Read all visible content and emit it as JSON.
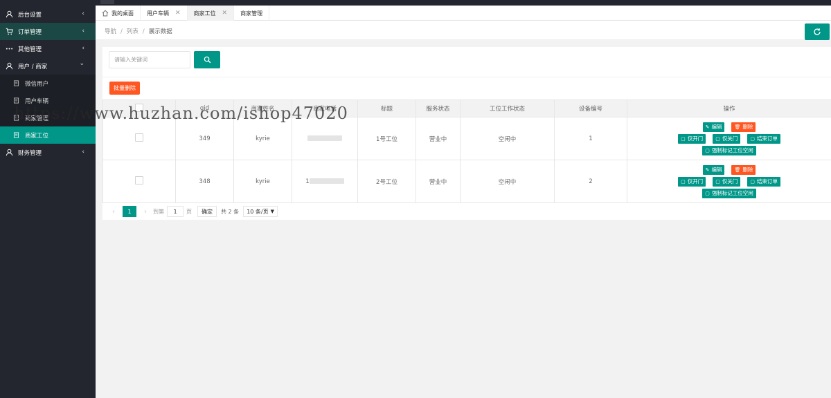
{
  "sidebar": {
    "items": [
      {
        "label": "后台设置",
        "icon": "user-icon",
        "arrow": "‹"
      },
      {
        "label": "订单管理",
        "icon": "cart-icon",
        "arrow": "‹"
      },
      {
        "label": "其他管理",
        "icon": "dots-icon",
        "arrow": "‹"
      },
      {
        "label": "用户 / 商家",
        "icon": "user-icon",
        "arrow": "⌄"
      },
      {
        "label": "微信用户",
        "icon": "doc-icon"
      },
      {
        "label": "用户车辆",
        "icon": "doc-icon"
      },
      {
        "label": "商家管理",
        "icon": "doc-icon"
      },
      {
        "label": "商家工位",
        "icon": "doc-icon"
      },
      {
        "label": "财务管理",
        "icon": "user-icon",
        "arrow": "‹"
      }
    ]
  },
  "tabs": [
    {
      "label": "我的桌面"
    },
    {
      "label": "用户车辆"
    },
    {
      "label": "商家工位"
    },
    {
      "label": "商家管理"
    }
  ],
  "breadcrumb": {
    "nav": "导航",
    "list": "列表",
    "show": "展示数据"
  },
  "search": {
    "placeholder": "请输入关键词"
  },
  "batch_delete": "批量删除",
  "table": {
    "columns": [
      "gid",
      "商家姓名",
      "商家电话",
      "标题",
      "服务状态",
      "工位工作状态",
      "设备编号",
      "操作"
    ],
    "rows": [
      {
        "gid": "349",
        "name": "kyrie",
        "phone": "",
        "title": "1号工位",
        "service": "营业中",
        "work": "空闲中",
        "device": "1"
      },
      {
        "gid": "348",
        "name": "kyrie",
        "phone": "1",
        "title": "2号工位",
        "service": "营业中",
        "work": "空闲中",
        "device": "2"
      }
    ],
    "ops": {
      "edit": "编辑",
      "delete": "删除",
      "open": "仅开门",
      "close": "仅关门",
      "end": "结束订单",
      "force": "强制标记工位空闲"
    }
  },
  "pager": {
    "current": "1",
    "goto": "到第",
    "page_value": "1",
    "page_unit": "页",
    "ok": "确定",
    "total": "共 2 条",
    "size": "10 条/页"
  },
  "watermark": "https://www.huzhan.com/ishop47020",
  "colors": {
    "primary": "#009688",
    "danger": "#ff5722",
    "sidebar": "#23262e"
  }
}
